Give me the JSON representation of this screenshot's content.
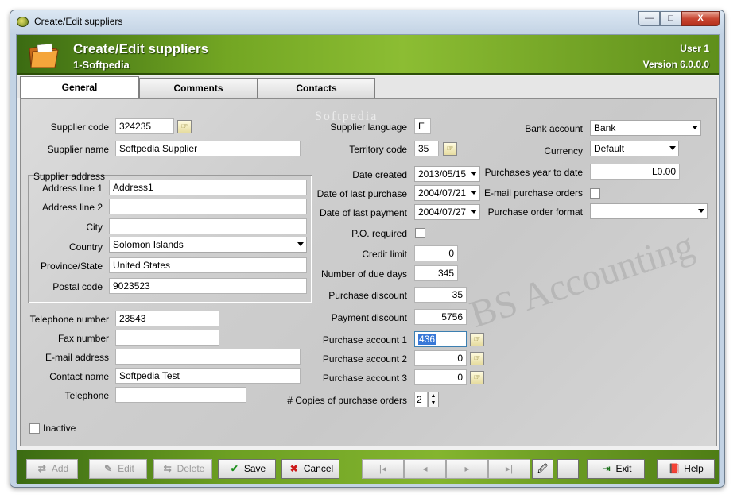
{
  "window": {
    "title": "Create/Edit suppliers",
    "min_label": "—",
    "max_label": "□",
    "close_label": "X"
  },
  "header": {
    "title": "Create/Edit suppliers",
    "subtitle": "1-Softpedia",
    "user": "User 1",
    "version": "Version 6.0.0.0"
  },
  "tabs": [
    {
      "label": "General",
      "active": true
    },
    {
      "label": "Comments",
      "active": false
    },
    {
      "label": "Contacts",
      "active": false
    }
  ],
  "watermark": "Softpedia",
  "watermark_text": "BS Accounting",
  "form": {
    "supplier_code": {
      "label": "Supplier code",
      "value": "324235"
    },
    "supplier_name": {
      "label": "Supplier name",
      "value": "Softpedia Supplier"
    },
    "supplier_address": {
      "label": "Supplier address",
      "address_line_1": {
        "label": "Address line 1",
        "value": "Address1"
      },
      "address_line_2": {
        "label": "Address line 2",
        "value": ""
      },
      "city": {
        "label": "City",
        "value": ""
      },
      "country": {
        "label": "Country",
        "value": "Solomon Islands"
      },
      "province_state": {
        "label": "Province/State",
        "value": "United States"
      },
      "postal_code": {
        "label": "Postal code",
        "value": "9023523"
      }
    },
    "telephone_number": {
      "label": "Telephone number",
      "value": "23543"
    },
    "fax_number": {
      "label": "Fax number",
      "value": ""
    },
    "email_address": {
      "label": "E-mail address",
      "value": ""
    },
    "contact_name": {
      "label": "Contact name",
      "value": "Softpedia Test"
    },
    "telephone": {
      "label": "Telephone",
      "value": ""
    },
    "inactive": {
      "label": "Inactive",
      "checked": false
    },
    "supplier_language": {
      "label": "Supplier language",
      "value": "E"
    },
    "territory_code": {
      "label": "Territory code",
      "value": "35"
    },
    "date_created": {
      "label": "Date created",
      "value": "2013/05/15"
    },
    "date_last_purchase": {
      "label": "Date of last purchase",
      "value": "2004/07/21"
    },
    "date_last_payment": {
      "label": "Date of last payment",
      "value": "2004/07/27"
    },
    "po_required": {
      "label": "P.O. required",
      "checked": false
    },
    "credit_limit": {
      "label": "Credit limit",
      "value": "0"
    },
    "due_days": {
      "label": "Number of due days",
      "value": "345"
    },
    "purchase_discount": {
      "label": "Purchase discount",
      "value": "35"
    },
    "payment_discount": {
      "label": "Payment discount",
      "value": "5756"
    },
    "purchase_account_1": {
      "label": "Purchase account 1",
      "value": "436"
    },
    "purchase_account_2": {
      "label": "Purchase account 2",
      "value": "0"
    },
    "purchase_account_3": {
      "label": "Purchase account 3",
      "value": "0"
    },
    "copies_po": {
      "label": "# Copies of purchase orders",
      "value": "2"
    },
    "bank_account": {
      "label": "Bank account",
      "value": "Bank"
    },
    "currency": {
      "label": "Currency",
      "value": "Default"
    },
    "purchases_ytd": {
      "label": "Purchases year to date",
      "value": "L0.00"
    },
    "email_po": {
      "label": "E-mail purchase orders",
      "checked": false
    },
    "po_format": {
      "label": "Purchase order format",
      "value": ""
    }
  },
  "toolbar": {
    "add": "Add",
    "edit": "Edit",
    "delete": "Delete",
    "save": "Save",
    "cancel": "Cancel",
    "exit": "Exit",
    "help": "Help"
  },
  "colors": {
    "header_green": "#6c9f22",
    "selection_blue": "#3878d7"
  }
}
